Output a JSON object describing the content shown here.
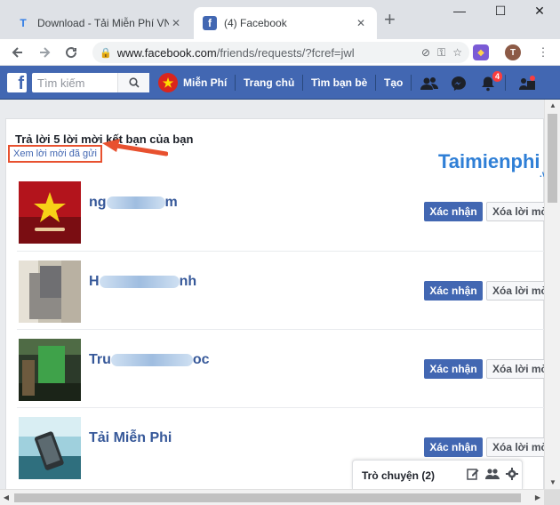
{
  "browser": {
    "tabs": [
      {
        "title": "Download - Tải Miễn Phí VN - ",
        "favicon": "T",
        "active": false
      },
      {
        "title": "(4) Facebook",
        "favicon": "f",
        "active": true
      }
    ],
    "url_host": "www.facebook.com",
    "url_path": "/friends/requests/?fcref=jwl",
    "profile_initial": "T",
    "window_controls": {
      "minimize": "—",
      "maximize": "☐",
      "close": "✕"
    }
  },
  "facebook": {
    "search_placeholder": "Tìm kiếm",
    "user_name": "Miễn Phí",
    "nav": [
      "Trang chủ",
      "Tìm bạn bè",
      "Tạo"
    ],
    "notification_count": "4",
    "brand_color": "#4267b2"
  },
  "page": {
    "heading": "Trả lời 5 lời mời kết bạn của bạn",
    "sent_link": "Xem lời mời đã gửi",
    "watermark": "Taimienphi",
    "watermark_suffix": ".vn"
  },
  "requests": [
    {
      "name_start": "ng",
      "name_end": "m",
      "confirm": "Xác nhận",
      "delete": "Xóa lời mời"
    },
    {
      "name_start": "H",
      "name_end": "nh",
      "confirm": "Xác nhận",
      "delete": "Xóa lời mời"
    },
    {
      "name_start": "Tru",
      "name_end": "oc",
      "confirm": "Xác nhận",
      "delete": "Xóa lời mời"
    },
    {
      "name_start": "Tải Miễn Phi",
      "name_end": "",
      "confirm": "Xác nhận",
      "delete": "Xóa lời mời"
    }
  ],
  "chat": {
    "label": "Trò chuyện (2)"
  }
}
